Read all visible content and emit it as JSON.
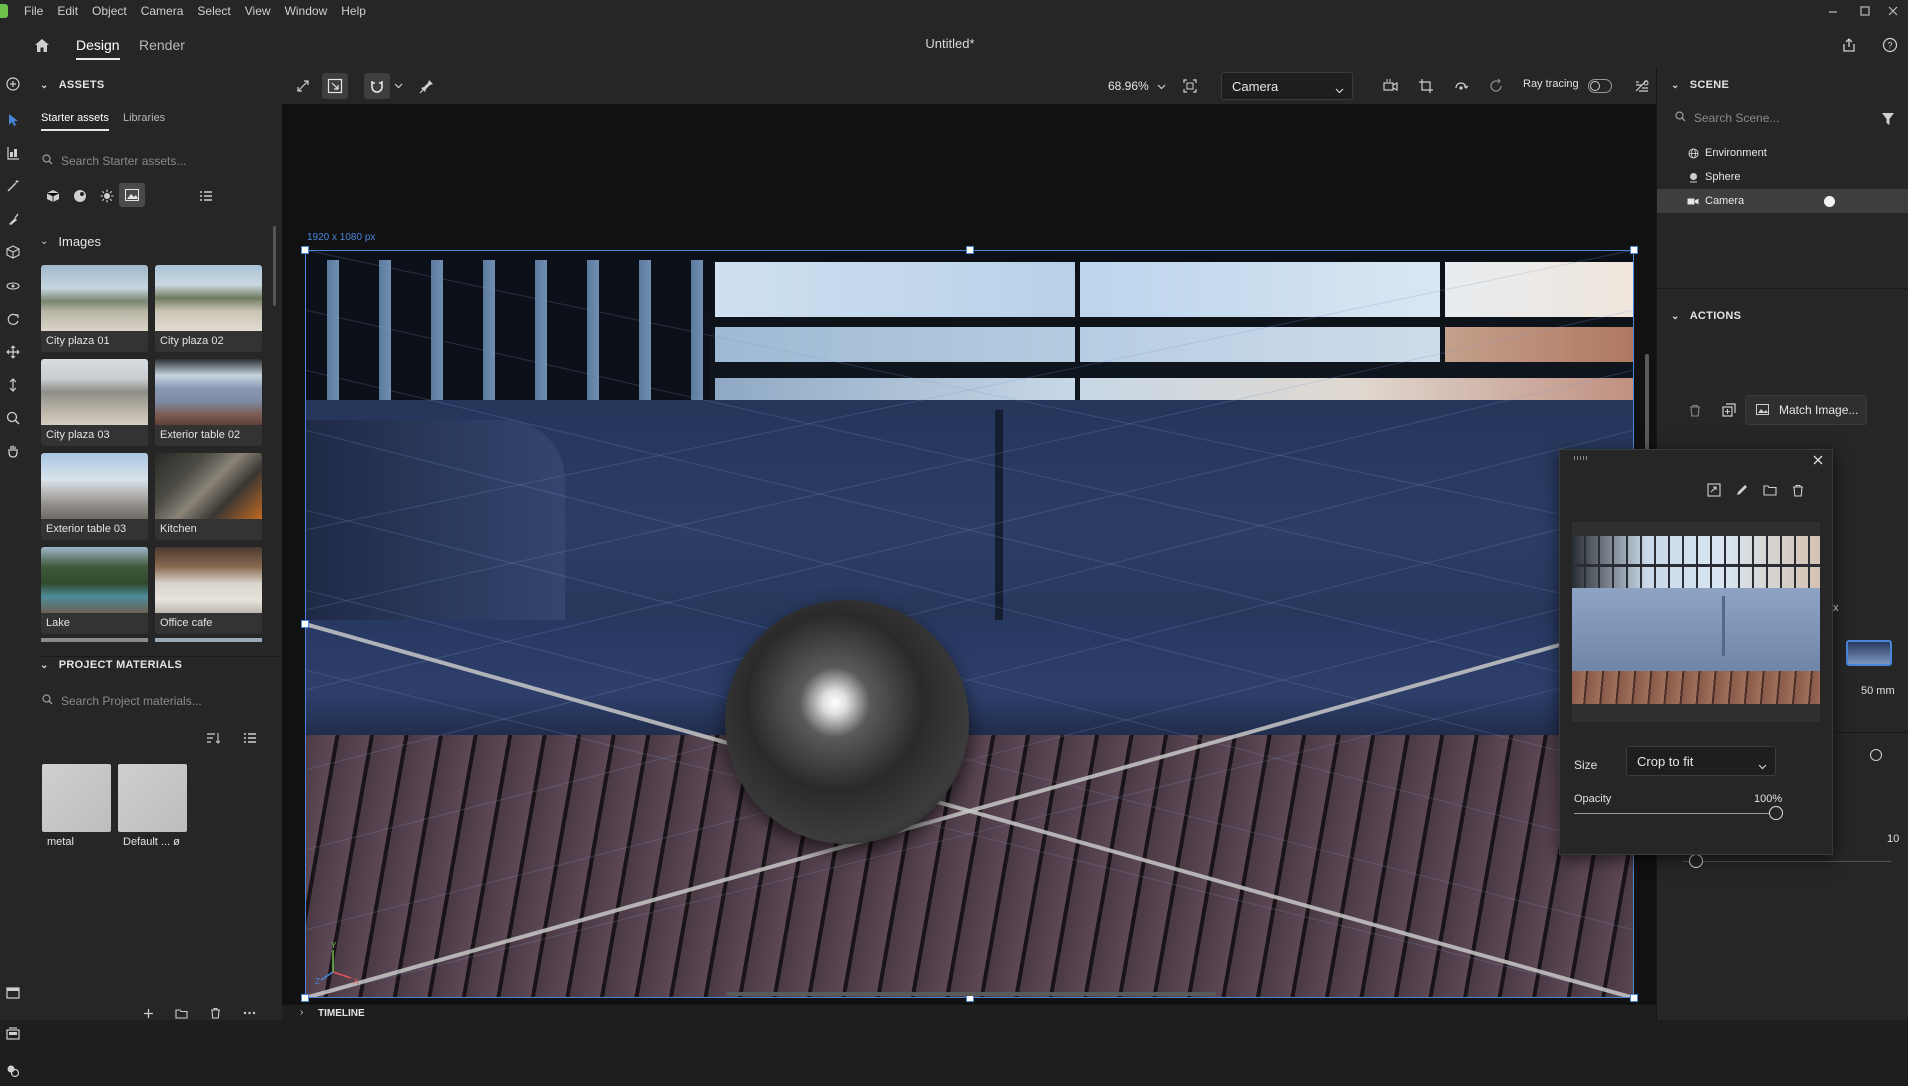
{
  "menubar": {
    "items": [
      "File",
      "Edit",
      "Object",
      "Camera",
      "Select",
      "View",
      "Window",
      "Help"
    ]
  },
  "titlebar": {
    "tabs": {
      "design": "Design",
      "render": "Render"
    },
    "document_title": "Untitled*"
  },
  "assets": {
    "heading": "ASSETS",
    "tabs": {
      "starter": "Starter assets",
      "libraries": "Libraries"
    },
    "search_placeholder": "Search Starter assets...",
    "images_heading": "Images",
    "images": [
      {
        "label": "City plaza 01"
      },
      {
        "label": "City plaza 02"
      },
      {
        "label": "City plaza 03"
      },
      {
        "label": "Exterior table 02"
      },
      {
        "label": "Exterior table 03"
      },
      {
        "label": "Kitchen"
      },
      {
        "label": "Lake"
      },
      {
        "label": "Office cafe"
      }
    ]
  },
  "project_materials": {
    "heading": "PROJECT MATERIALS",
    "search_placeholder": "Search Project materials...",
    "materials": [
      {
        "label": "metal"
      },
      {
        "label": "Default ... ø"
      }
    ]
  },
  "viewport_toolbar": {
    "zoom": "68.96%",
    "camera_select": "Camera",
    "ray_tracing_label": "Ray tracing",
    "ray_tracing_on": false
  },
  "viewport": {
    "size_label": "1920 x 1080 px",
    "axis_labels": {
      "y": "Y",
      "z": "Z",
      "x": "X"
    }
  },
  "timeline": {
    "label": "TIMELINE"
  },
  "scene": {
    "heading": "SCENE",
    "search_placeholder": "Search Scene...",
    "items": [
      {
        "label": "Environment",
        "icon": "globe-icon"
      },
      {
        "label": "Sphere",
        "icon": "sphere-object-icon"
      },
      {
        "label": "Camera",
        "icon": "camera-icon",
        "selected": true
      }
    ]
  },
  "actions": {
    "heading": "ACTIONS",
    "match_image_label": "Match Image..."
  },
  "properties_partial": {
    "x_fragment": "x",
    "focal_length": "50 mm",
    "value_10": "10"
  },
  "popup": {
    "size_label": "Size",
    "size_value": "Crop to fit",
    "opacity_label": "Opacity",
    "opacity_value": "100%",
    "opacity_fraction": 1.0
  },
  "colors": {
    "accent_blue": "#4a86d8",
    "panel_bg": "#262626",
    "app_bg": "#1e1e1e"
  }
}
